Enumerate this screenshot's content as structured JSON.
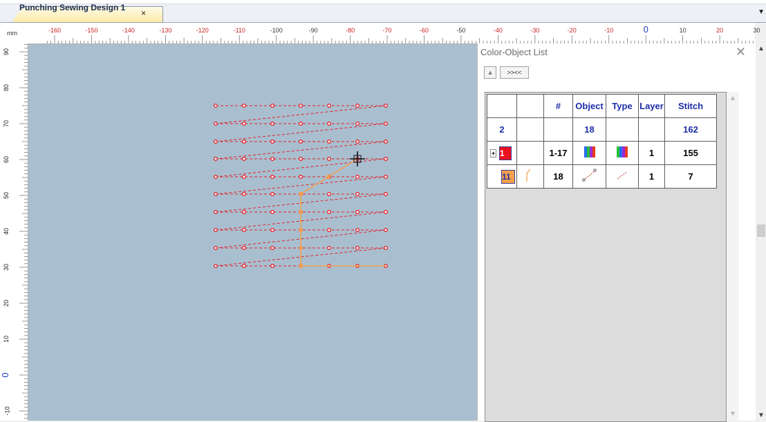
{
  "tab": {
    "title": "Punching Sewing Design 1",
    "close_glyph": "×",
    "dropdown_glyph": "▼"
  },
  "ruler": {
    "unit": "mm",
    "top_labels": [
      "-160",
      "-150",
      "-140",
      "-130",
      "-120",
      "-110",
      "-100",
      "-90",
      "-80",
      "-70",
      "-60",
      "-50",
      "-40",
      "-30",
      "-20",
      "-10",
      "0",
      "10",
      "20",
      "30"
    ],
    "left_labels": [
      "90",
      "80",
      "70",
      "60",
      "50",
      "40",
      "30",
      "20",
      "10",
      "0",
      "-10"
    ]
  },
  "panel": {
    "title": "Color-Object List",
    "close_glyph": "✕",
    "collapse_button": "⩓",
    "expand_button": ">><<",
    "headers": [
      "",
      "",
      "#",
      "Object",
      "Type",
      "Layer",
      "Stitch"
    ],
    "summary": {
      "colors": "2",
      "objects": "18",
      "stitches": "162"
    },
    "rows": [
      {
        "expander": "+",
        "color_index": "1",
        "color": "#e8121e",
        "range": "1-17",
        "layer": "1",
        "stitch": "155",
        "object_icon": "color-wheel-icon",
        "type_icon": "color-wheel-icon"
      },
      {
        "expander": "",
        "color_index": "11",
        "color": "#f5a04a",
        "range": "18",
        "layer": "1",
        "stitch": "7",
        "object_icon": "running-stitch-icon",
        "type_icon": "running-stitch-icon"
      }
    ],
    "scroll_up": "▲",
    "scroll_down": "▼"
  },
  "colors": {
    "stitch_red": "#e3202a",
    "stitch_orange": "#f2a050",
    "canvas": "#a9bfcf"
  }
}
